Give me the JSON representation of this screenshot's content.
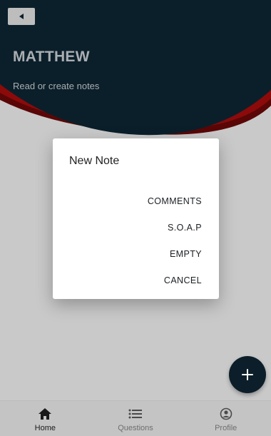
{
  "header": {
    "title": "MATTHEW",
    "subtitle": "Read or create notes",
    "back_icon": "back-arrow-icon"
  },
  "dialog": {
    "title": "New Note",
    "actions": [
      "COMMENTS",
      "S.O.A.P",
      "EMPTY",
      "CANCEL"
    ]
  },
  "fab": {
    "icon": "plus-icon"
  },
  "bottom_nav": {
    "items": [
      {
        "label": "Home",
        "icon": "home-icon",
        "active": true
      },
      {
        "label": "Questions",
        "icon": "list-icon",
        "active": false
      },
      {
        "label": "Profile",
        "icon": "profile-icon",
        "active": false
      }
    ]
  },
  "colors": {
    "header_dark": "#0b1f2a",
    "accent_red": "#8c0a0a",
    "overlay_gray": "#c9c9c9",
    "dialog_bg": "#ffffff"
  }
}
